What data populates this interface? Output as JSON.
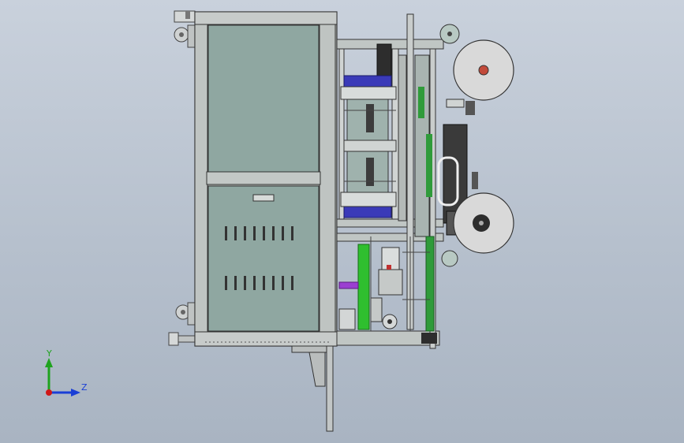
{
  "viewport": {
    "triad": {
      "y_label": "Y",
      "z_label": "Z",
      "y_color": "#1fa31f",
      "z_color": "#1a3fd6",
      "x_color": "#d01818"
    },
    "colors": {
      "background_top": "#c9d1dc",
      "background_bottom": "#a9b4c2",
      "frame": "#b3b8b6",
      "panel": "#8fa7a1",
      "cylinder_green": "#2fbf2f",
      "motor_blue": "#3a3ab8",
      "accent_purple": "#9b3fd1",
      "reel": "#d9d9d9"
    }
  }
}
